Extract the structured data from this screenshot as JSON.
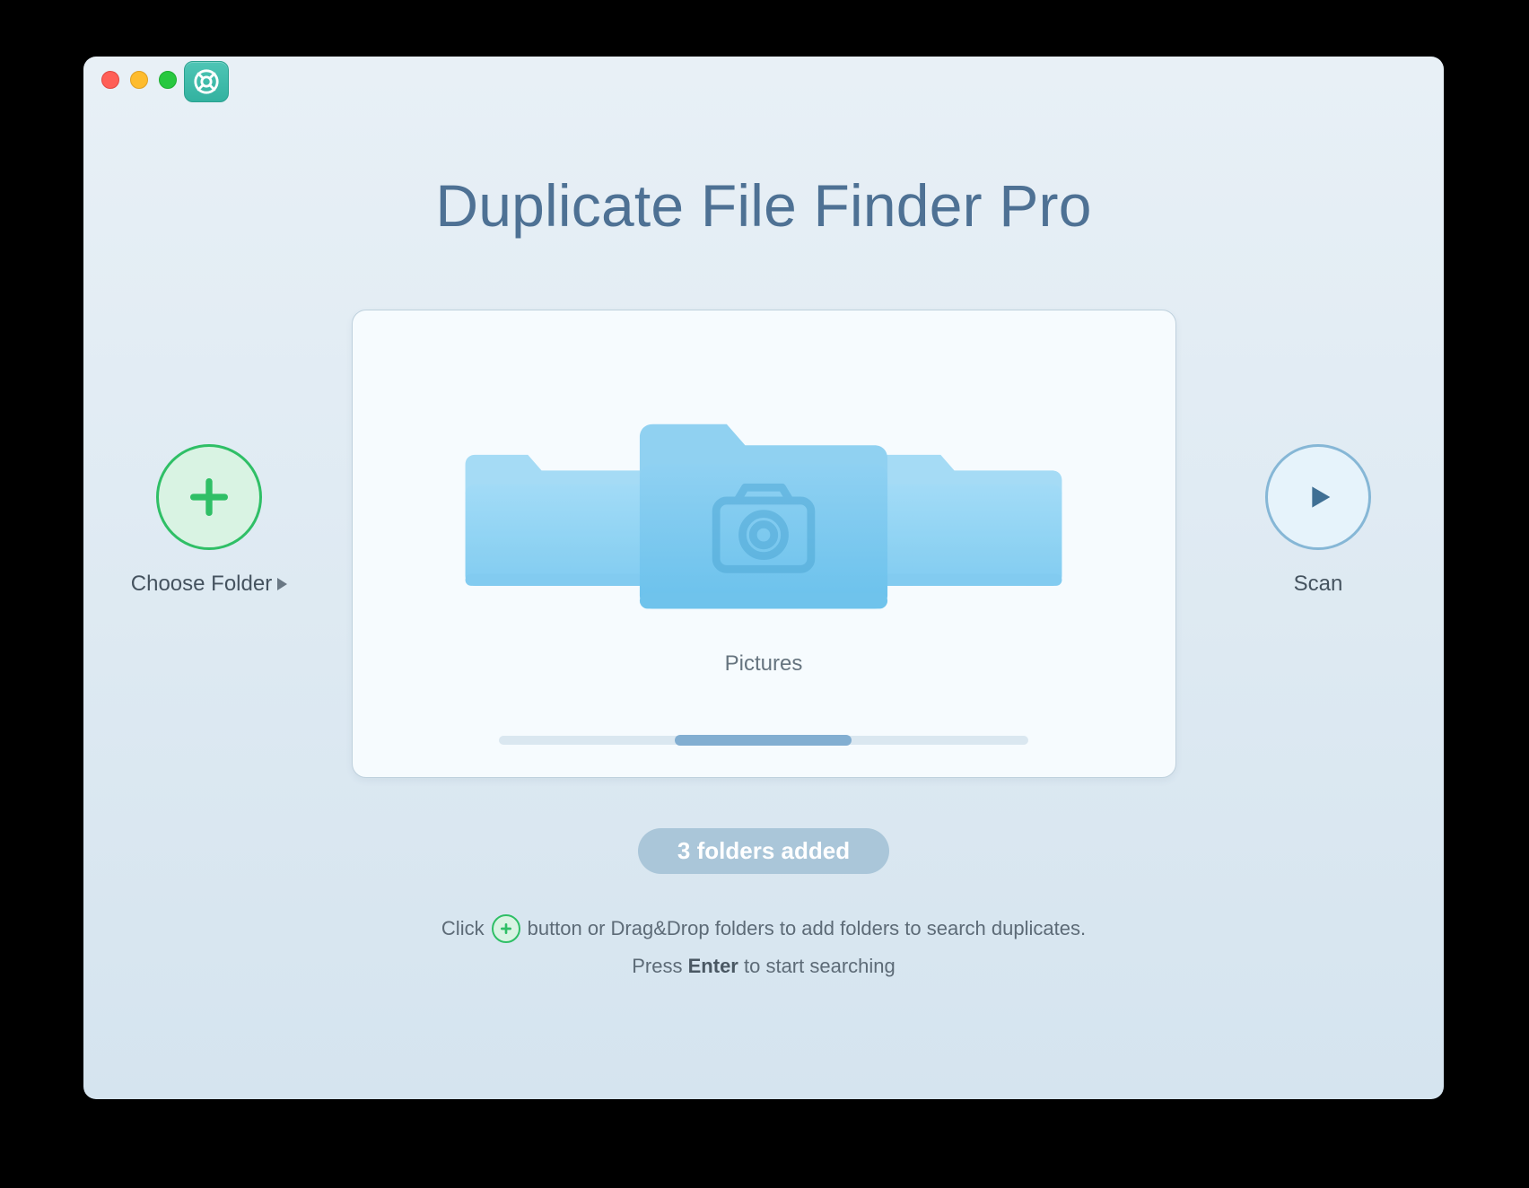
{
  "app": {
    "title": "Duplicate File Finder Pro"
  },
  "buttons": {
    "choose_folder_label": "Choose Folder",
    "scan_label": "Scan"
  },
  "carousel": {
    "selected_label": "Pictures",
    "scroll_position_fraction": 0.333,
    "scroll_thumb_fraction": 0.333,
    "folders": [
      {
        "name": "",
        "is_selected": false,
        "icon": "folder-icon"
      },
      {
        "name": "Pictures",
        "is_selected": true,
        "icon": "pictures-folder-icon"
      },
      {
        "name": "",
        "is_selected": false,
        "icon": "folder-icon"
      }
    ]
  },
  "status": {
    "badge": "3 folders added"
  },
  "hints": {
    "line1_before": "Click",
    "line1_after": "button or Drag&Drop folders to add folders to search duplicates.",
    "line2_before": "Press",
    "line2_bold": "Enter",
    "line2_after": "to start searching"
  },
  "colors": {
    "accent_green": "#2fbf66",
    "accent_blue": "#4c89b8",
    "folder_primary": "#6cc2ec",
    "title": "#4e7194"
  }
}
